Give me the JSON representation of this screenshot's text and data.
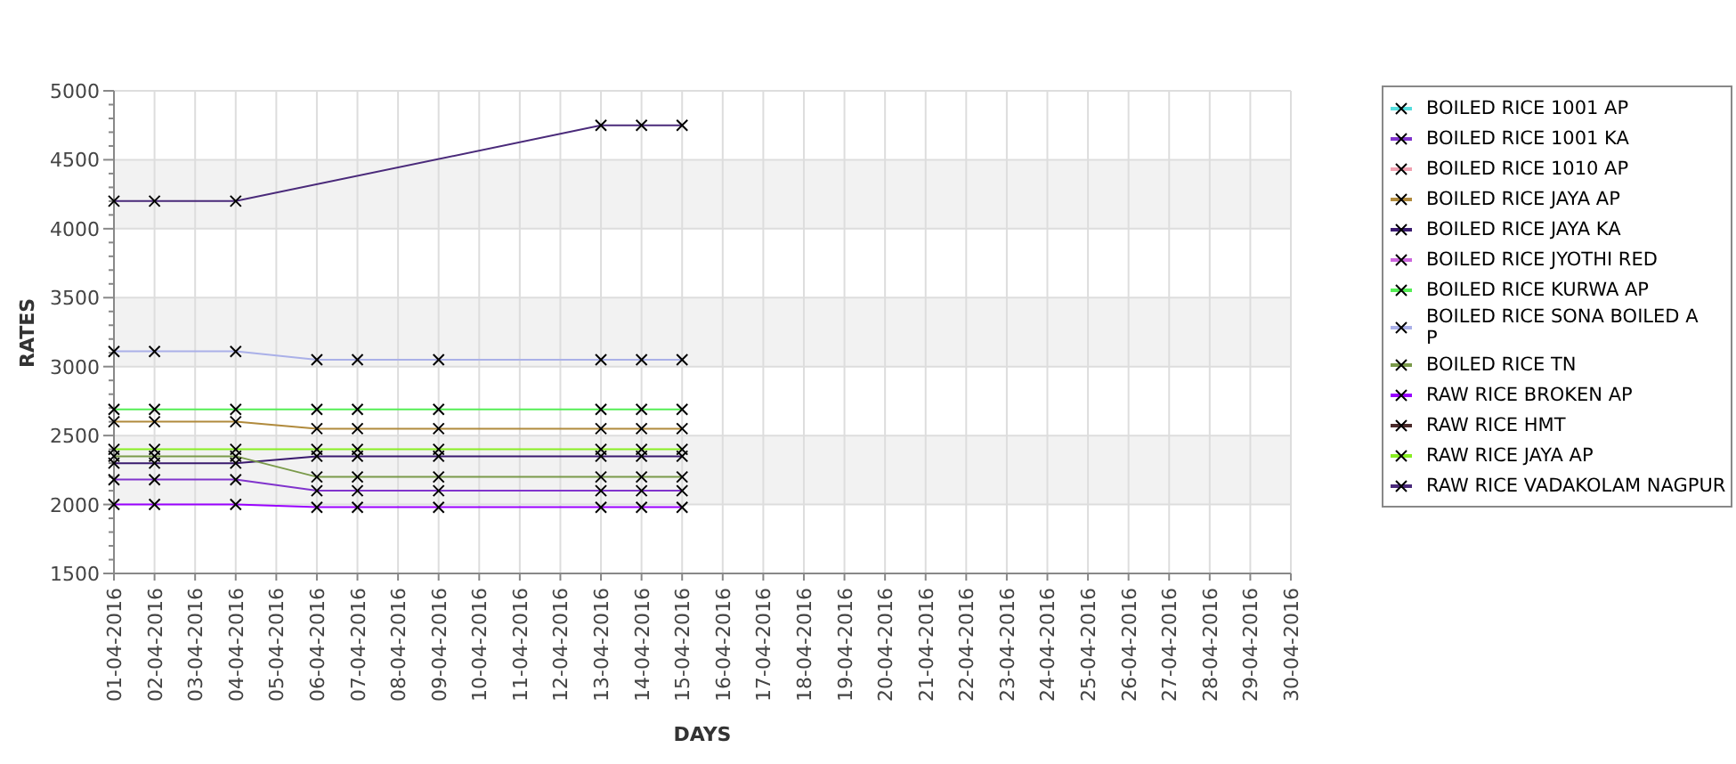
{
  "chart": {
    "chart_data": {
      "type": "line",
      "xlabel": "DAYS",
      "ylabel": "RATES",
      "categories": [
        "01-04-2016",
        "02-04-2016",
        "03-04-2016",
        "04-04-2016",
        "05-04-2016",
        "06-04-2016",
        "07-04-2016",
        "08-04-2016",
        "09-04-2016",
        "10-04-2016",
        "11-04-2016",
        "12-04-2016",
        "13-04-2016",
        "14-04-2016",
        "15-04-2016",
        "16-04-2016",
        "17-04-2016",
        "18-04-2016",
        "19-04-2016",
        "20-04-2016",
        "21-04-2016",
        "22-04-2016",
        "23-04-2016",
        "24-04-2016",
        "25-04-2016",
        "26-04-2016",
        "27-04-2016",
        "28-04-2016",
        "29-04-2016",
        "30-04-2016"
      ],
      "ylim": [
        1500,
        5000
      ],
      "grid": true,
      "yticks": [
        1500,
        2000,
        2500,
        3000,
        3500,
        4000,
        4500,
        5000
      ],
      "series": [
        {
          "marker": "x",
          "name": "BOILED RICE 1001 AP",
          "color": "#55dddd",
          "values": [
            null,
            null,
            null,
            null,
            null,
            null,
            null,
            null,
            null,
            null,
            null,
            null,
            null,
            null,
            null,
            null,
            null,
            null,
            null,
            null,
            null,
            null,
            null,
            null,
            null,
            null,
            null,
            null,
            null,
            null
          ]
        },
        {
          "marker": "x",
          "name": "BOILED RICE 1001 KA",
          "color": "#8033cc",
          "values": [
            2180,
            2180,
            null,
            2180,
            null,
            2100,
            2100,
            null,
            2100,
            null,
            null,
            null,
            2100,
            2100,
            2100,
            null,
            null,
            null,
            null,
            null,
            null,
            null,
            null,
            null,
            null,
            null,
            null,
            null,
            null,
            null
          ]
        },
        {
          "marker": "x",
          "name": "BOILED RICE 1010 AP",
          "color": "#f0a0b0",
          "values": [
            null,
            null,
            null,
            null,
            null,
            null,
            null,
            null,
            null,
            null,
            null,
            null,
            null,
            null,
            null,
            null,
            null,
            null,
            null,
            null,
            null,
            null,
            null,
            null,
            null,
            null,
            null,
            null,
            null,
            null
          ]
        },
        {
          "marker": "x",
          "name": "BOILED RICE JAYA AP",
          "color": "#b08a3c",
          "values": [
            2600,
            2600,
            null,
            2600,
            null,
            2550,
            2550,
            null,
            2550,
            null,
            null,
            null,
            2550,
            2550,
            2550,
            null,
            null,
            null,
            null,
            null,
            null,
            null,
            null,
            null,
            null,
            null,
            null,
            null,
            null,
            null
          ]
        },
        {
          "marker": "x",
          "name": "BOILED RICE JAYA KA",
          "color": "#3a1a6e",
          "values": [
            2300,
            2300,
            null,
            2300,
            null,
            2350,
            2350,
            null,
            2350,
            null,
            null,
            null,
            2350,
            2350,
            2350,
            null,
            null,
            null,
            null,
            null,
            null,
            null,
            null,
            null,
            null,
            null,
            null,
            null,
            null,
            null
          ]
        },
        {
          "marker": "x",
          "name": "BOILED RICE JYOTHI RED",
          "color": "#cc66dd",
          "values": [
            null,
            null,
            null,
            null,
            null,
            null,
            null,
            null,
            null,
            null,
            null,
            null,
            null,
            null,
            null,
            null,
            null,
            null,
            null,
            null,
            null,
            null,
            null,
            null,
            null,
            null,
            null,
            null,
            null,
            null
          ]
        },
        {
          "marker": "x",
          "name": "BOILED RICE KURWA AP",
          "color": "#55ee55",
          "values": [
            2690,
            2690,
            null,
            2690,
            null,
            2690,
            2690,
            null,
            2690,
            null,
            null,
            null,
            2690,
            2690,
            2690,
            null,
            null,
            null,
            null,
            null,
            null,
            null,
            null,
            null,
            null,
            null,
            null,
            null,
            null,
            null
          ]
        },
        {
          "marker": "x",
          "name": "BOILED RICE SONA BOILED A\nP",
          "color": "#aab0e8",
          "values": [
            3110,
            3110,
            null,
            3110,
            null,
            3050,
            3050,
            null,
            3050,
            null,
            null,
            null,
            3050,
            3050,
            3050,
            null,
            null,
            null,
            null,
            null,
            null,
            null,
            null,
            null,
            null,
            null,
            null,
            null,
            null,
            null
          ]
        },
        {
          "marker": "x",
          "name": "BOILED RICE TN",
          "color": "#7a9a4a",
          "values": [
            2350,
            2350,
            null,
            2350,
            null,
            2200,
            2200,
            null,
            2200,
            null,
            null,
            null,
            2200,
            2200,
            2200,
            null,
            null,
            null,
            null,
            null,
            null,
            null,
            null,
            null,
            null,
            null,
            null,
            null,
            null,
            null
          ]
        },
        {
          "marker": "x",
          "name": "RAW RICE BROKEN AP",
          "color": "#9900ff",
          "values": [
            2000,
            2000,
            null,
            2000,
            null,
            1980,
            1980,
            null,
            1980,
            null,
            null,
            null,
            1980,
            1980,
            1980,
            null,
            null,
            null,
            null,
            null,
            null,
            null,
            null,
            null,
            null,
            null,
            null,
            null,
            null,
            null
          ]
        },
        {
          "marker": "x",
          "name": "RAW RICE HMT",
          "color": "#4a2a2a",
          "values": [
            null,
            null,
            null,
            null,
            null,
            null,
            null,
            null,
            null,
            null,
            null,
            null,
            null,
            null,
            null,
            null,
            null,
            null,
            null,
            null,
            null,
            null,
            null,
            null,
            null,
            null,
            null,
            null,
            null,
            null
          ]
        },
        {
          "marker": "x",
          "name": "RAW RICE JAYA AP",
          "color": "#88ee22",
          "values": [
            2400,
            2400,
            null,
            2400,
            null,
            2400,
            2400,
            null,
            2400,
            null,
            null,
            null,
            2400,
            2400,
            2400,
            null,
            null,
            null,
            null,
            null,
            null,
            null,
            null,
            null,
            null,
            null,
            null,
            null,
            null,
            null
          ]
        },
        {
          "marker": "x",
          "name": "RAW RICE VADAKOLAM NAGPUR",
          "color": "#4a2a7a",
          "values": [
            4200,
            4200,
            null,
            4200,
            null,
            null,
            null,
            null,
            null,
            null,
            null,
            null,
            4750,
            4750,
            4750,
            null,
            null,
            null,
            null,
            null,
            null,
            null,
            null,
            null,
            null,
            null,
            null,
            null,
            null,
            null
          ]
        }
      ]
    }
  }
}
